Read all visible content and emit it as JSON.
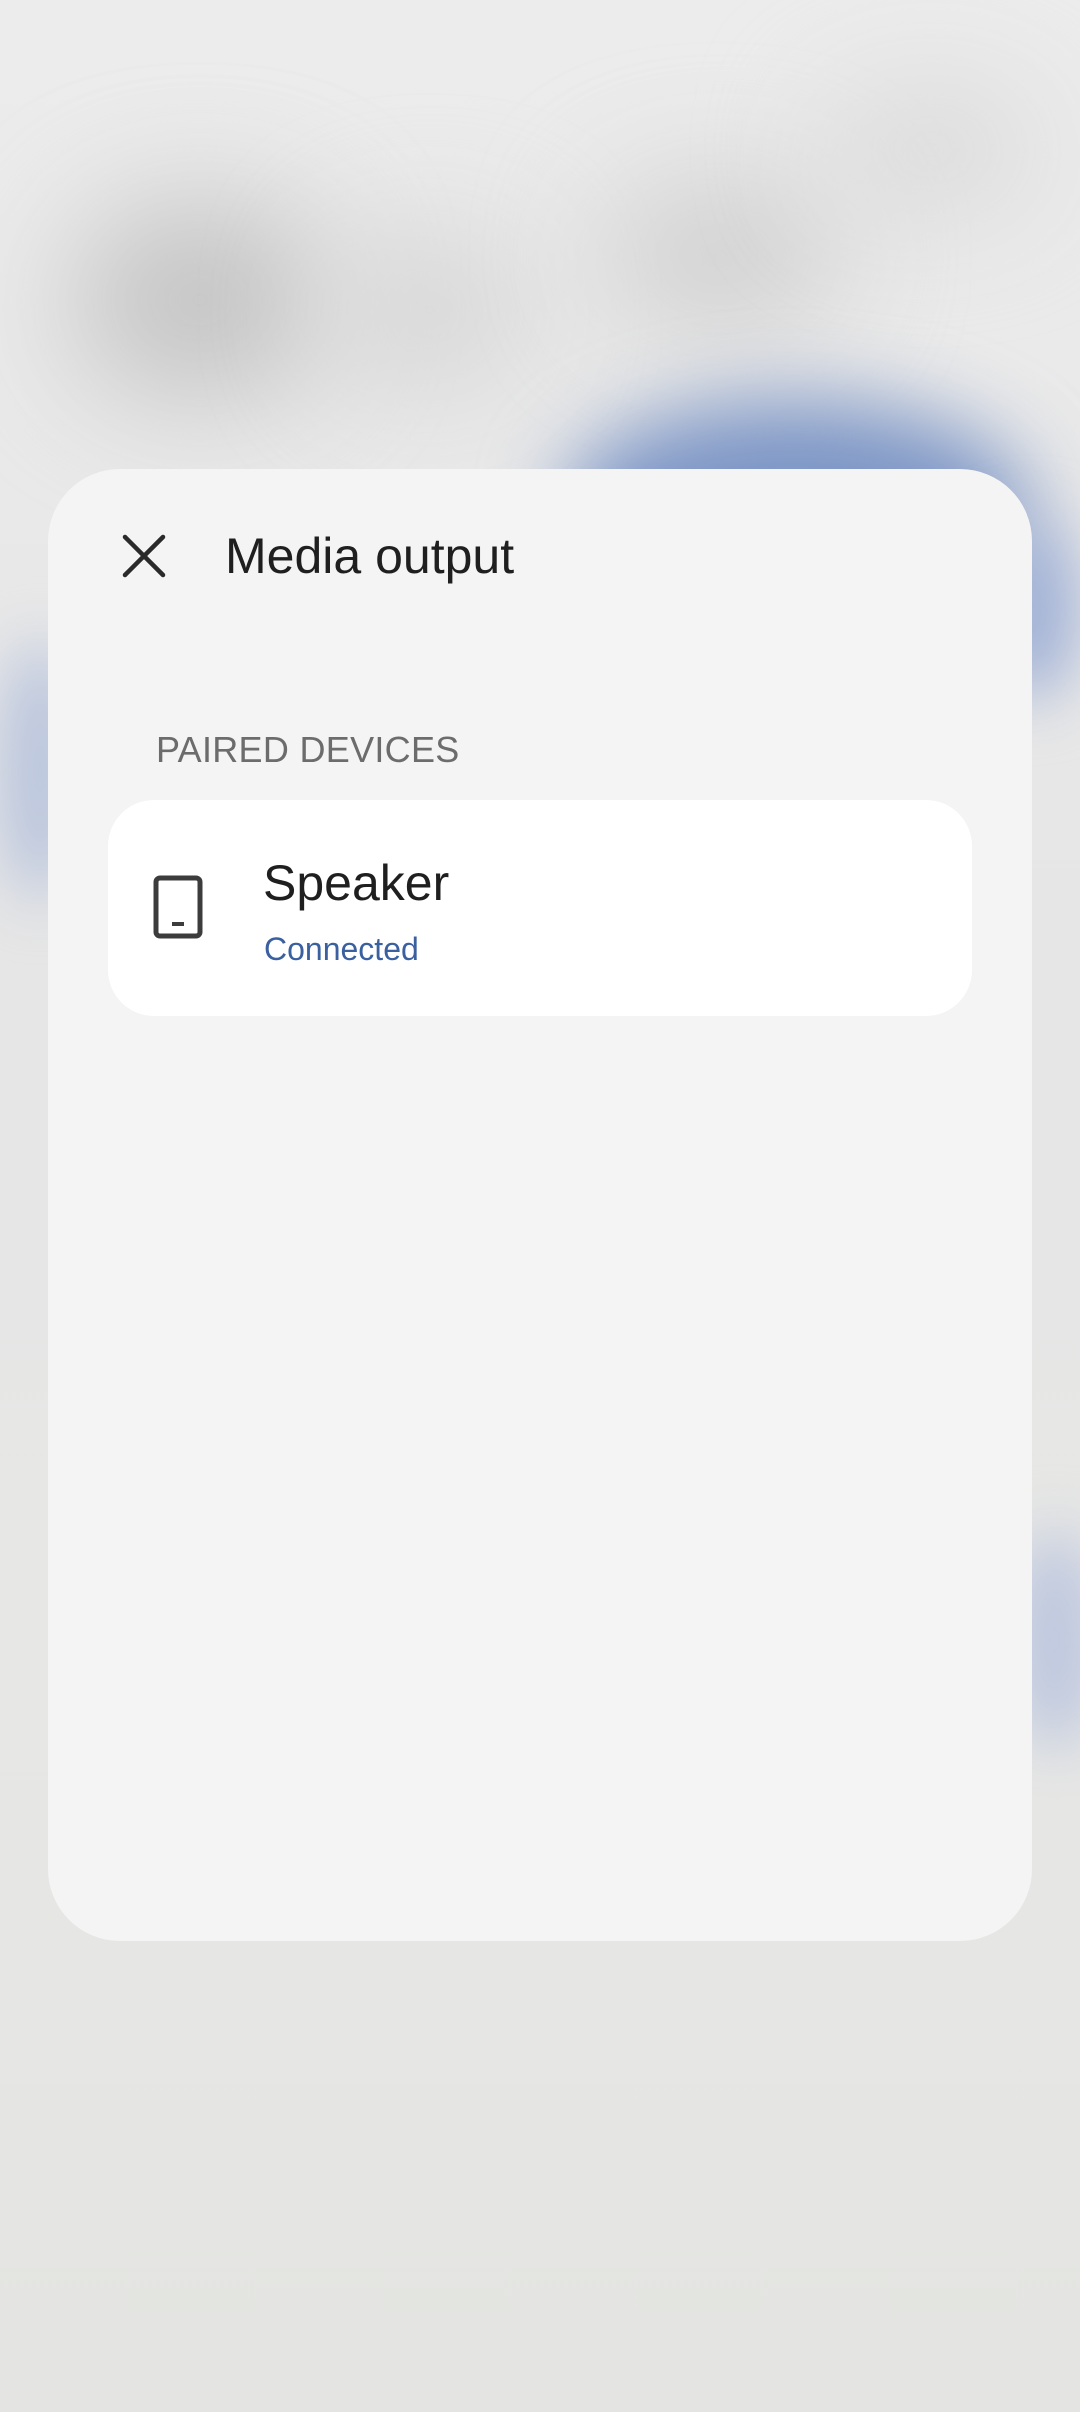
{
  "dialog": {
    "title": "Media output",
    "close_icon": "close-icon"
  },
  "paired_devices": {
    "header": "PAIRED DEVICES",
    "items": [
      {
        "name": "Speaker",
        "status": "Connected",
        "icon": "phone-speaker-icon"
      }
    ]
  },
  "colors": {
    "sheet_background": "#f4f4f4",
    "card_background": "#ffffff",
    "status_accent": "#3a60a0",
    "title_text": "#1f1f1f",
    "section_header_text": "#6c6c6c"
  }
}
